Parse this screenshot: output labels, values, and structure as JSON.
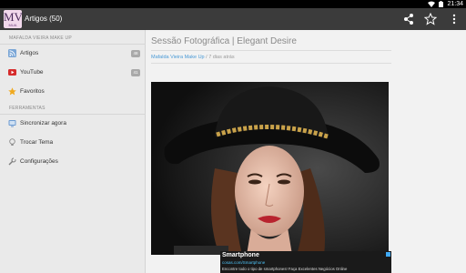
{
  "status_bar": {
    "time": "21:34"
  },
  "app_bar": {
    "logo_text": "MV",
    "logo_subtext": "MUA",
    "title": "Artigos (50)",
    "actions": [
      "share-icon",
      "star-icon",
      "overflow-menu-icon"
    ]
  },
  "drawer": {
    "sections": [
      {
        "header": "MAFALDA VIEIRA MAKE UP",
        "items": [
          {
            "label": "Artigos",
            "icon": "rss-icon",
            "count": "48"
          },
          {
            "label": "YouTube",
            "icon": "youtube-icon",
            "count": "41"
          },
          {
            "label": "Favoritos",
            "icon": "star-icon",
            "count": ""
          }
        ]
      },
      {
        "header": "FERRAMENTAS",
        "items": [
          {
            "label": "Sincronizar agora",
            "icon": "sync-icon",
            "count": ""
          },
          {
            "label": "Trocar Tema",
            "icon": "lightbulb-icon",
            "count": ""
          },
          {
            "label": "Configurações",
            "icon": "wrench-icon",
            "count": ""
          }
        ]
      }
    ]
  },
  "article": {
    "title": "Sessão Fotográfica | Elegant Desire",
    "author": "Mafalda Vieira Make Up",
    "separator": "/",
    "age": "7 dias atrás"
  },
  "ad": {
    "title": "Smartphone",
    "url": "cosas.com/Smartphone",
    "description": "Encontre todo o tipo de smartphones! Faça Excelentes Negócios Online"
  },
  "colors": {
    "status_bar": "#000000",
    "action_bar": "#3b3b3b",
    "drawer_bg": "#eaeaea",
    "content_bg": "#f2f2f2",
    "author_link": "#4a9ad6",
    "badge": "#a9a9a9"
  }
}
